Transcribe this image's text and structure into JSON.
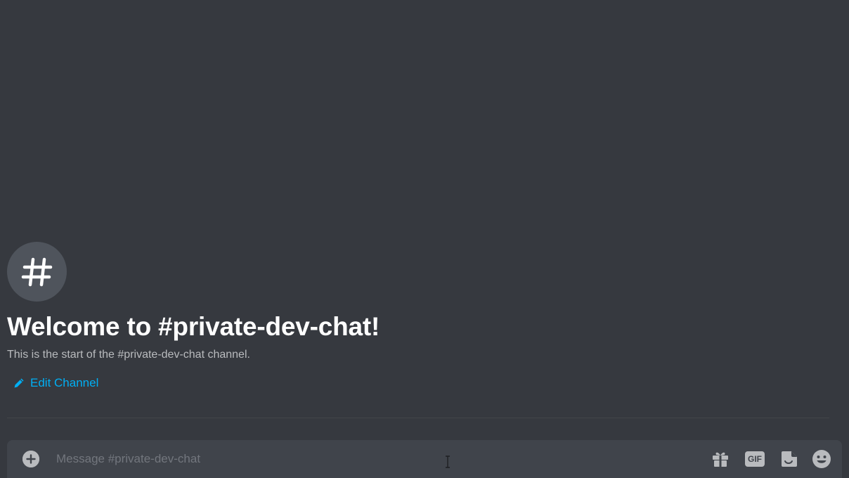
{
  "channel": {
    "name": "#private-dev-chat",
    "avatar_glyph": "#",
    "welcome_title": "Welcome to #private-dev-chat!",
    "welcome_subtitle": "This is the start of the #private-dev-chat channel.",
    "edit_label": "Edit Channel"
  },
  "composer": {
    "placeholder": "Message #private-dev-chat",
    "value": "",
    "gif_label": "GIF",
    "icons": [
      "add-circle-icon",
      "gift-icon",
      "gif-icon",
      "sticker-icon",
      "emoji-icon"
    ]
  },
  "colors": {
    "background": "#36393f",
    "composer_bg": "#40444b",
    "link": "#00aff4",
    "title": "#ffffff",
    "subtitle": "#b9bbbe",
    "icon": "#b9bbbe"
  }
}
